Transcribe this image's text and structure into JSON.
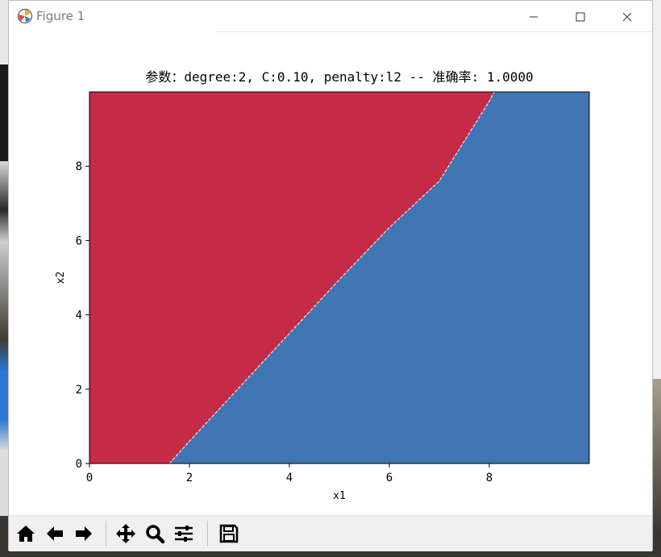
{
  "window": {
    "title": "Figure 1"
  },
  "toolbar": {
    "buttons": [
      "home",
      "back",
      "forward",
      "pan",
      "zoom",
      "configure-subplots",
      "save"
    ]
  },
  "chart_data": {
    "type": "decision-boundary",
    "title": "参数：degree:2, C:0.10, penalty:l2 -- 准确率: 1.0000",
    "xlabel": "x1",
    "ylabel": "x2",
    "xlim": [
      0,
      10
    ],
    "ylim": [
      0,
      10
    ],
    "xticks": [
      0,
      2,
      4,
      6,
      8
    ],
    "yticks": [
      0,
      2,
      4,
      6,
      8
    ],
    "grid": false,
    "regions": [
      {
        "side": "upper-left",
        "color": "#c52a47"
      },
      {
        "side": "lower-right",
        "color": "#3f76b3"
      }
    ],
    "boundary": {
      "x": [
        1.6,
        2.0,
        3.0,
        4.0,
        5.0,
        6.0,
        7.0,
        8.0,
        8.1
      ],
      "y": [
        0.0,
        0.6,
        2.05,
        3.5,
        4.95,
        6.35,
        7.6,
        9.75,
        10.0
      ]
    }
  }
}
